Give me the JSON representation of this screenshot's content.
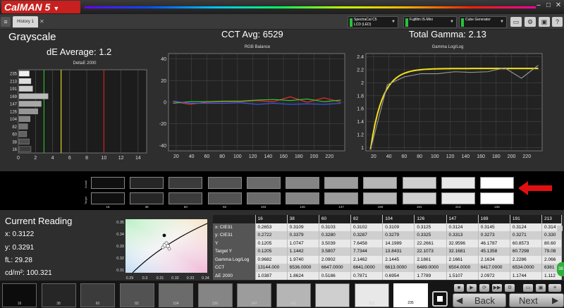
{
  "app": {
    "logo": "CalMAN 5",
    "tab": "History 1",
    "devices": [
      {
        "line1": "SpectraCal C5",
        "line2": "LCD (LED)"
      },
      {
        "line1": "Fujifilm IS-Mini",
        "line2": ""
      },
      {
        "line1": "Cube Generator",
        "line2": ""
      }
    ]
  },
  "summary": {
    "title": "Grayscale",
    "de_average": "dE Average: 1.2",
    "cct_avg": "CCT Avg: 6529",
    "total_gamma": "Total Gamma: 2.13"
  },
  "charts": {
    "deltae": {
      "title": "DeltaE 2000",
      "levels": [
        "235",
        "213",
        "191",
        "169",
        "147",
        "126",
        "104",
        "82",
        "60",
        "38",
        "16"
      ],
      "bar_values": [
        1.2,
        1.4,
        1.6,
        3.4,
        2.6,
        2.2,
        1.3,
        1.0,
        0.9,
        1.2,
        1.4
      ],
      "xticks": [
        "0",
        "2",
        "4",
        "6",
        "8",
        "10",
        "12",
        "14"
      ],
      "xlim": [
        0,
        15
      ],
      "thresholds": [
        {
          "value": 3,
          "color": "#2cc42c"
        },
        {
          "value": 5,
          "color": "#e6e61e"
        },
        {
          "value": 10,
          "color": "#e02020"
        }
      ]
    },
    "rgb": {
      "title": "RGB Balance",
      "xticks": [
        "20",
        "40",
        "60",
        "80",
        "100",
        "120",
        "140",
        "160",
        "180",
        "200",
        "220"
      ],
      "yticks": [
        "40",
        "20",
        "0",
        "-20",
        "-40"
      ],
      "ylim": [
        -45,
        45
      ],
      "xlim": [
        10,
        240
      ],
      "x": [
        16,
        38,
        60,
        82,
        104,
        126,
        147,
        169,
        191,
        213,
        235
      ],
      "series": [
        {
          "color": "#ff2a2a",
          "values": [
            0.5,
            -2,
            0,
            0.5,
            0.5,
            1.5,
            0.5,
            5,
            0,
            4,
            0
          ]
        },
        {
          "color": "#2fd42f",
          "values": [
            -1,
            0.5,
            0.5,
            1,
            1,
            2,
            2.5,
            1.5,
            3,
            0.5,
            2
          ]
        },
        {
          "color": "#3a5cff",
          "values": [
            1,
            -1,
            -1,
            -1,
            -0.5,
            -2,
            -1,
            -2,
            -1.5,
            -2,
            -1
          ]
        }
      ]
    },
    "gamma": {
      "title": "Gamma Log/Log",
      "xticks": [
        "20",
        "40",
        "60",
        "80",
        "100",
        "120",
        "140",
        "160",
        "180",
        "200",
        "220"
      ],
      "yticks": [
        "2.4",
        "2.2",
        "2",
        "1.8",
        "1.6",
        "1.4",
        "1.2",
        "1"
      ],
      "ylim": [
        0.95,
        2.45
      ],
      "xlim": [
        10,
        240
      ],
      "x": [
        16,
        38,
        60,
        82,
        104,
        126,
        147,
        169,
        191,
        213,
        235
      ],
      "measured": [
        0.97,
        1.97,
        2.09,
        2.14,
        2.14,
        2.17,
        2.16,
        2.17,
        2.23,
        2.07,
        2.27
      ],
      "target_gamma": 2.22
    }
  },
  "swatches": {
    "row_labels": [
      "Actual",
      "Target"
    ],
    "levels": [
      "16",
      "38",
      "60",
      "82",
      "104",
      "126",
      "147",
      "169",
      "191",
      "213",
      "235"
    ],
    "grays": [
      "#101010",
      "#262626",
      "#3b3b3b",
      "#525252",
      "#6b6b6b",
      "#858585",
      "#9c9c9c",
      "#b5b5b5",
      "#cfcfcf",
      "#e8e8e8",
      "#ffffff"
    ]
  },
  "current_reading": {
    "title": "Current Reading",
    "x": "x: 0.3122",
    "y": "y: 0.3291",
    "fl": "fL: 29.28",
    "cdm2": "cd/m²: 100.321"
  },
  "cie": {
    "yticks": [
      "0.35",
      "0.34",
      "0.33",
      "0.32",
      "0.31"
    ],
    "xticks": [
      "0.29",
      "0.3",
      "0.31",
      "0.32",
      "0.33",
      "0.34"
    ]
  },
  "table": {
    "columns": [
      "",
      "16",
      "38",
      "60",
      "82",
      "104",
      "126",
      "147",
      "169",
      "191",
      "213"
    ],
    "rows": [
      {
        "label": "x: CIE31",
        "values": [
          "0.2653",
          "0.3109",
          "0.3103",
          "0.3102",
          "0.3109",
          "0.3125",
          "0.3124",
          "0.3145",
          "0.3124",
          "0.314"
        ]
      },
      {
        "label": "y: CIE31",
        "values": [
          "0.2722",
          "0.3379",
          "0.3280",
          "0.3287",
          "0.3279",
          "0.3325",
          "0.3313",
          "0.3273",
          "0.3271",
          "0.330"
        ]
      },
      {
        "label": "Y",
        "values": [
          "0.1205",
          "1.0747",
          "3.5039",
          "7.6458",
          "14.1989",
          "22.2661",
          "32.9596",
          "46.1787",
          "60.8573",
          "80.60"
        ]
      },
      {
        "label": "Target Y",
        "values": [
          "0.1205",
          "1.1442",
          "3.5807",
          "7.7344",
          "13.8431",
          "22.1073",
          "32.1681",
          "45.1358",
          "60.7298",
          "79.08"
        ]
      },
      {
        "label": "Gamma Log/Log",
        "values": [
          "0.9682",
          "1.9740",
          "2.0902",
          "2.1462",
          "2.1445",
          "2.1861",
          "2.1661",
          "2.1634",
          "2.2286",
          "2.066"
        ]
      },
      {
        "label": "CCT",
        "values": [
          "13144.000",
          "6536.0000",
          "6647.0000",
          "6641.0000",
          "6613.0000",
          "6489.0000",
          "6504.0000",
          "6417.0000",
          "6534.0000",
          "6381"
        ]
      },
      {
        "label": "ΔE 2000",
        "values": [
          "1.0387",
          "1.8624",
          "0.5186",
          "0.7871",
          "0.6954",
          "1.7789",
          "1.5107",
          "2.0972",
          "1.1744",
          "1.112"
        ]
      }
    ]
  },
  "patches": {
    "labels": [
      "16",
      "38",
      "60",
      "82",
      "104",
      "126",
      "147",
      "169",
      "191",
      "213",
      "235"
    ],
    "grays": [
      "#0c0c0c",
      "#262626",
      "#3b3b3b",
      "#525252",
      "#6b6b6b",
      "#858585",
      "#9c9c9c",
      "#b5b5b5",
      "#cfcfcf",
      "#e8e8e8",
      "#ffffff"
    ],
    "selected": "235"
  },
  "nav": {
    "back": "Back",
    "next": "Next"
  }
}
